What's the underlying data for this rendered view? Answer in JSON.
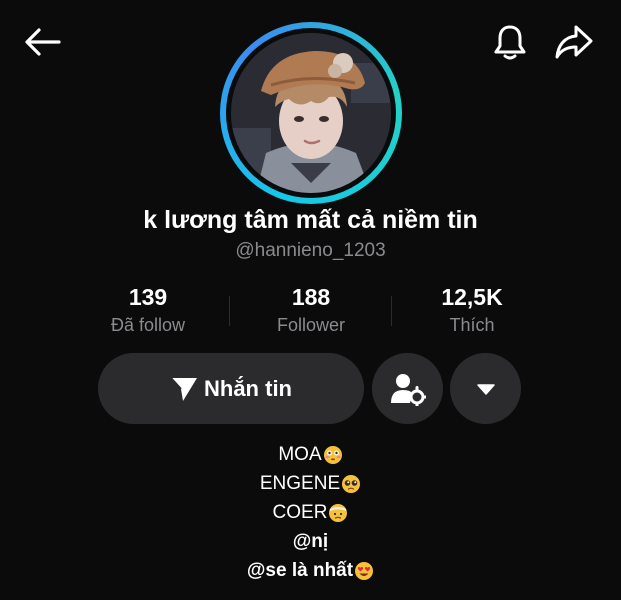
{
  "profile": {
    "display_name": "k lương tâm mất cả niềm tin",
    "username": "@hannieno_1203"
  },
  "stats": [
    {
      "value": "139",
      "label": "Đã follow"
    },
    {
      "value": "188",
      "label": "Follower"
    },
    {
      "value": "12,5K",
      "label": "Thích"
    }
  ],
  "actions": {
    "message_label": "Nhắn tin"
  },
  "bio": [
    {
      "text": "MOA",
      "emoji": "flushed-face",
      "bold": false
    },
    {
      "text": "ENGENE",
      "emoji": "pleading-face",
      "bold": false
    },
    {
      "text": "COER",
      "emoji": "face-with-head-bandage",
      "bold": false
    },
    {
      "text": "@nị",
      "emoji": "",
      "bold": true
    },
    {
      "text": "@se là nhất",
      "emoji": "heart-eyes-face",
      "bold": true
    }
  ],
  "icons": {
    "back": "back-arrow-icon",
    "bell": "bell-icon",
    "share": "share-icon",
    "send": "send-icon",
    "person_settings": "person-settings-icon",
    "dropdown": "chevron-down-icon"
  },
  "colors": {
    "background": "#0b0b0b",
    "button": "#2b2b2d",
    "secondary_text": "#8b8b8f",
    "avatar_ring": "#16c7e8"
  }
}
